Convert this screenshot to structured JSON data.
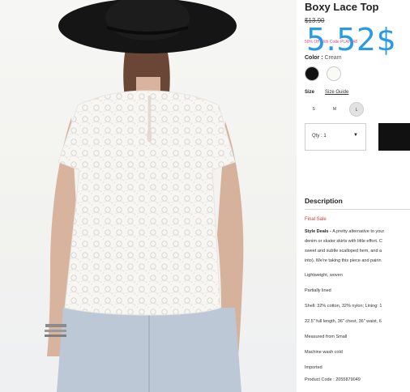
{
  "product": {
    "title": "Boxy Lace Top",
    "original_price": "$13.90",
    "promo_text": "50% Off With Code PLAY548",
    "overlay_price": "5.52$",
    "color_label": "Color :",
    "color_value": "Cream",
    "swatches": [
      {
        "name": "Black",
        "hex": "#121212"
      },
      {
        "name": "Cream",
        "hex": "#fafaf5",
        "selected": true
      }
    ],
    "size_label": "Size",
    "size_guide": "Size Guide",
    "sizes": [
      "S",
      "M",
      "L"
    ],
    "selected_size": "L",
    "qty_label": "Qty : 1",
    "add_to_bag": ""
  },
  "description": {
    "heading": "Description",
    "final_sale": "Final Sale",
    "lead_bold": "Style Deals - ",
    "lead_line1": "A pretty alternative to your",
    "line2": "denim or skater skirts with little effort. C",
    "line3": "sweet and subtle scalloped hem, and a",
    "line4": "into). We're taking this piece and pairin",
    "details": [
      "Lightweight, woven",
      "Partially lined",
      "Shell: 32% cotton, 32% nylon; Lining: 1",
      "22.5\" full length, 36\" chest, 36\" waist, 6",
      "Measured from Small",
      "Machine wash cold",
      "Imported",
      "Product Code : 2055879049"
    ]
  },
  "colors": {
    "accent_overlay": "#2a9be2",
    "promo": "#e4457a",
    "final_sale": "#d03a3a"
  }
}
